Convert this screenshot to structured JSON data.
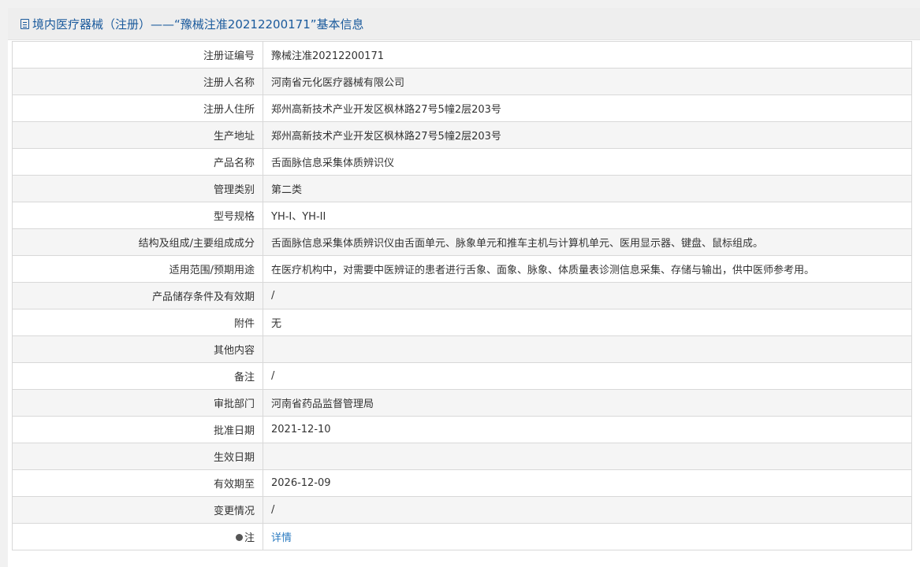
{
  "header": {
    "title": "境内医疗器械（注册）——“豫械注准20212200171”基本信息"
  },
  "rows": [
    {
      "label": "注册证编号",
      "value": "豫械注准20212200171"
    },
    {
      "label": "注册人名称",
      "value": "河南省元化医疗器械有限公司"
    },
    {
      "label": "注册人住所",
      "value": "郑州高新技术产业开发区枫林路27号5幢2层203号"
    },
    {
      "label": "生产地址",
      "value": "郑州高新技术产业开发区枫林路27号5幢2层203号"
    },
    {
      "label": "产品名称",
      "value": "舌面脉信息采集体质辨识仪"
    },
    {
      "label": "管理类别",
      "value": "第二类"
    },
    {
      "label": "型号规格",
      "value": "YH-I、YH-II"
    },
    {
      "label": "结构及组成/主要组成成分",
      "value": "舌面脉信息采集体质辨识仪由舌面单元、脉象单元和推车主机与计算机单元、医用显示器、键盘、鼠标组成。"
    },
    {
      "label": "适用范围/预期用途",
      "value": "在医疗机构中，对需要中医辨证的患者进行舌象、面象、脉象、体质量表诊测信息采集、存储与输出，供中医师参考用。"
    },
    {
      "label": "产品储存条件及有效期",
      "value": "/"
    },
    {
      "label": "附件",
      "value": "无"
    },
    {
      "label": "其他内容",
      "value": ""
    },
    {
      "label": "备注",
      "value": "/"
    },
    {
      "label": "审批部门",
      "value": "河南省药品监督管理局"
    },
    {
      "label": "批准日期",
      "value": "2021-12-10"
    },
    {
      "label": "生效日期",
      "value": ""
    },
    {
      "label": "有效期至",
      "value": "2026-12-09"
    },
    {
      "label": "变更情况",
      "value": "/"
    }
  ],
  "note_row": {
    "label": "注",
    "link": "详情",
    "icon": "pin-icon"
  }
}
